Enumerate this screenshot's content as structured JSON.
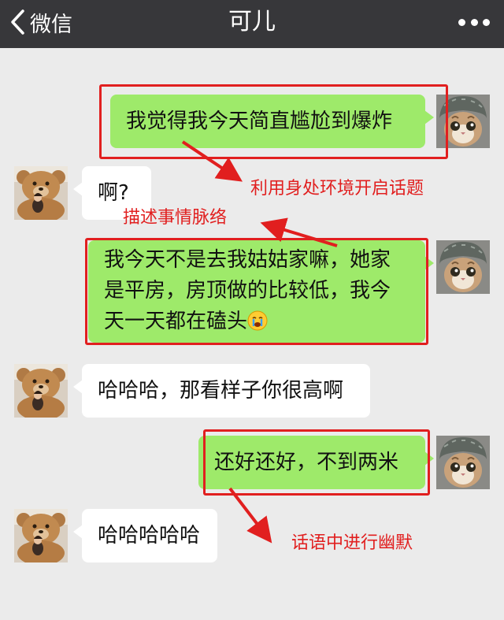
{
  "header": {
    "back_label": "微信",
    "title": "可儿"
  },
  "messages": [
    {
      "side": "right",
      "text": "我觉得我今天简直尴尬到爆炸"
    },
    {
      "side": "left",
      "text": "啊?"
    },
    {
      "side": "right",
      "lines": [
        "我今天不是去我姑姑家嘛，她家",
        "是平房，房顶做的比较低，我今",
        "天一天都在磕头"
      ],
      "emoji": "crying-face"
    },
    {
      "side": "left",
      "text": "哈哈哈，那看样子你很高啊"
    },
    {
      "side": "right",
      "text": "还好还好，不到两米"
    },
    {
      "side": "left",
      "text": "哈哈哈哈哈"
    }
  ],
  "annotations": {
    "note1": "利用身处环境开启话题",
    "note2": "描述事情脉络",
    "note3": "话语中进行幽默"
  },
  "colors": {
    "header_bg": "#37373a",
    "chat_bg": "#ebebeb",
    "sent_bubble": "#9eea6a",
    "received_bubble": "#ffffff",
    "annotation_red": "#e11f1f"
  },
  "avatars": {
    "self": "cat-in-knit-hat-avatar",
    "contact": "teddy-bear-avatar"
  }
}
